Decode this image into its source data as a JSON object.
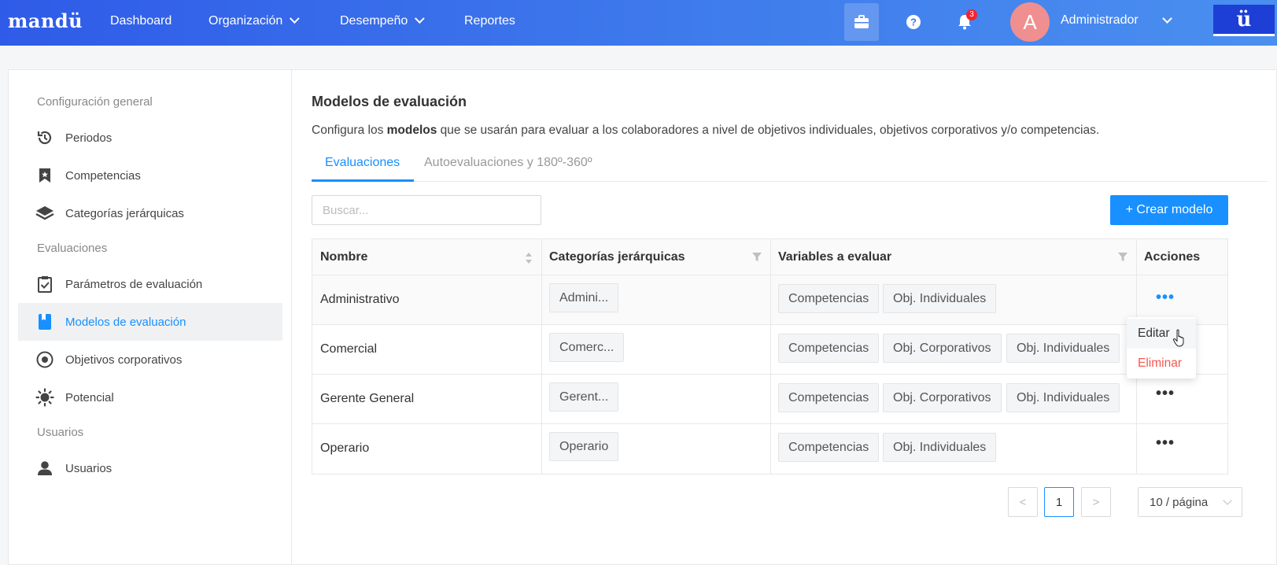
{
  "nav": {
    "brand": "mandü",
    "items": [
      {
        "label": "Dashboard"
      },
      {
        "label": "Organización"
      },
      {
        "label": "Desempeño"
      },
      {
        "label": "Reportes"
      }
    ],
    "notifications_count": "3",
    "avatar_letter": "A",
    "user_name": "Administrador",
    "logo_letter": "ü"
  },
  "sidebar": {
    "groups": [
      "Configuración general",
      "Evaluaciones",
      "Usuarios"
    ],
    "items": [
      {
        "label": "Periodos",
        "icon": "history-icon"
      },
      {
        "label": "Competencias",
        "icon": "bookmark-icon"
      },
      {
        "label": "Categorías jerárquicas",
        "icon": "layers-icon"
      },
      {
        "label": "Parámetros de evaluación",
        "icon": "clipboard-check-icon"
      },
      {
        "label": "Modelos de evaluación",
        "icon": "book-icon"
      },
      {
        "label": "Objetivos corporativos",
        "icon": "target-icon"
      },
      {
        "label": "Potencial",
        "icon": "sun-icon"
      },
      {
        "label": "Usuarios",
        "icon": "user-icon"
      }
    ]
  },
  "main": {
    "title": "Modelos de evaluación",
    "desc_before": "Configura los ",
    "desc_bold": "modelos",
    "desc_after": " que se usarán para evaluar a los colaboradores a nivel de objetivos individuales, objetivos corporativos y/o competencias.",
    "tabs": [
      "Evaluaciones",
      "Autoevaluaciones y 180º-360º"
    ],
    "search_placeholder": "Buscar...",
    "create_label": "+ Crear modelo"
  },
  "table": {
    "headers": [
      "Nombre",
      "Categorías jerárquicas",
      "Variables a evaluar",
      "Acciones"
    ],
    "rows": [
      {
        "name": "Administrativo",
        "category": "Admini...",
        "variables": [
          "Competencias",
          "Obj. Individuales"
        ]
      },
      {
        "name": "Comercial",
        "category": "Comerc...",
        "variables": [
          "Competencias",
          "Obj. Corporativos",
          "Obj. Individuales"
        ]
      },
      {
        "name": "Gerente General",
        "category": "Gerent...",
        "variables": [
          "Competencias",
          "Obj. Corporativos",
          "Obj. Individuales"
        ]
      },
      {
        "name": "Operario",
        "category": "Operario",
        "variables": [
          "Competencias",
          "Obj. Individuales"
        ]
      }
    ],
    "actions_glyph": "•••"
  },
  "menu": {
    "edit": "Editar",
    "delete": "Eliminar"
  },
  "pagination": {
    "prev": "<",
    "current": "1",
    "next": ">",
    "page_size": "10 / página"
  },
  "colors": {
    "primary": "#1890ff",
    "nav_start": "#2f5be8",
    "danger": "#f5574e"
  }
}
